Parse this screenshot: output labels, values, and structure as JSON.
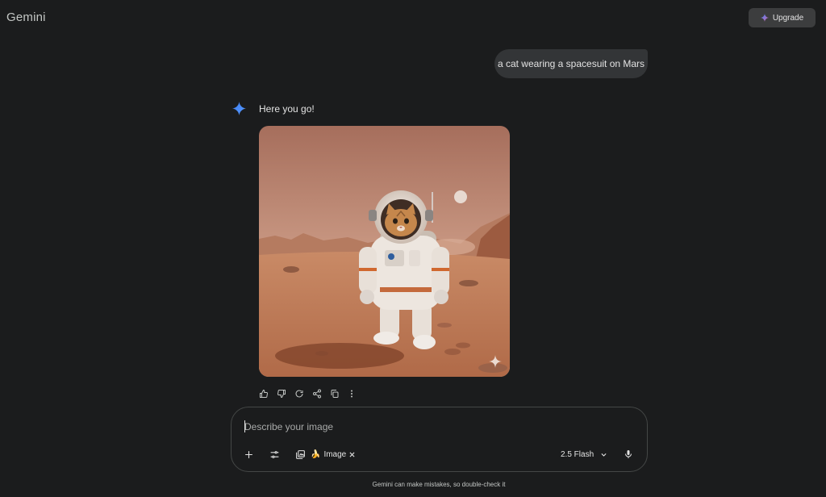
{
  "header": {
    "brand": "Gemini",
    "upgrade_label": "Upgrade"
  },
  "conversation": {
    "user_prompt": "a cat wearing a spacesuit on Mars",
    "model_reply": "Here you go!"
  },
  "response_actions": [
    {
      "name": "thumbs-up-icon"
    },
    {
      "name": "thumbs-down-icon"
    },
    {
      "name": "redo-icon"
    },
    {
      "name": "share-icon"
    },
    {
      "name": "copy-icon"
    },
    {
      "name": "more-vertical-icon"
    }
  ],
  "composer": {
    "placeholder": "Describe your image",
    "chip_label": "Image",
    "chip_icon": "banana-icon",
    "model_label": "2.5 Flash"
  },
  "footer": {
    "disclaimer": "Gemini can make mistakes, so double-check it"
  },
  "colors": {
    "background": "#1b1c1d",
    "bubble": "#333537",
    "gemini_blue": "#4285f4"
  }
}
